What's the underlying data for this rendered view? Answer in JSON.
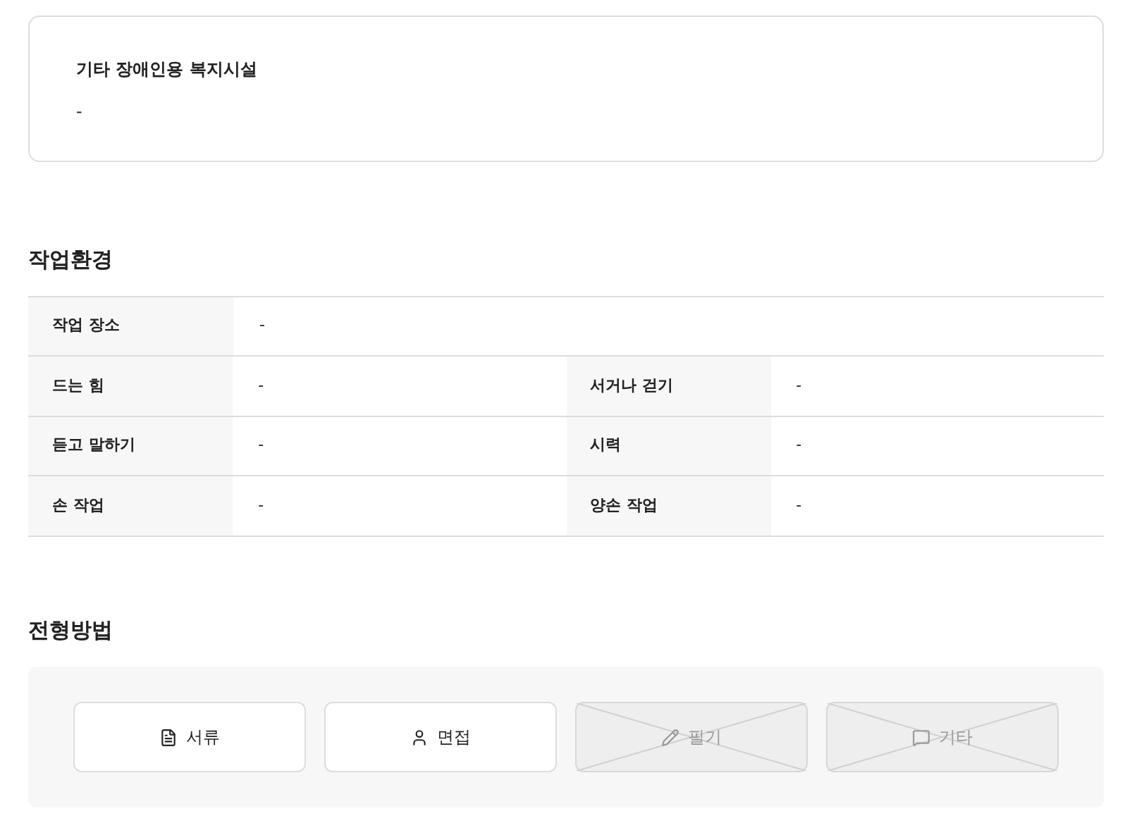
{
  "facility_card": {
    "title": "기타 장애인용 복지시설",
    "value": "-"
  },
  "work_environment": {
    "heading": "작업환경",
    "rows": [
      {
        "cells": [
          {
            "label": "작업 장소",
            "value": "-"
          }
        ]
      },
      {
        "cells": [
          {
            "label": "드는 힘",
            "value": "-"
          },
          {
            "label": "서거나 걷기",
            "value": "-"
          }
        ]
      },
      {
        "cells": [
          {
            "label": "듣고 말하기",
            "value": "-"
          },
          {
            "label": "시력",
            "value": "-"
          }
        ]
      },
      {
        "cells": [
          {
            "label": "손 작업",
            "value": "-"
          },
          {
            "label": "양손 작업",
            "value": "-"
          }
        ]
      }
    ]
  },
  "selection_methods": {
    "heading": "전형방법",
    "methods": [
      {
        "kind": "document",
        "label": "서류",
        "disabled": false
      },
      {
        "kind": "person",
        "label": "면접",
        "disabled": false
      },
      {
        "kind": "pencil",
        "label": "필기",
        "disabled": true
      },
      {
        "kind": "chat",
        "label": "기타",
        "disabled": true
      }
    ]
  }
}
